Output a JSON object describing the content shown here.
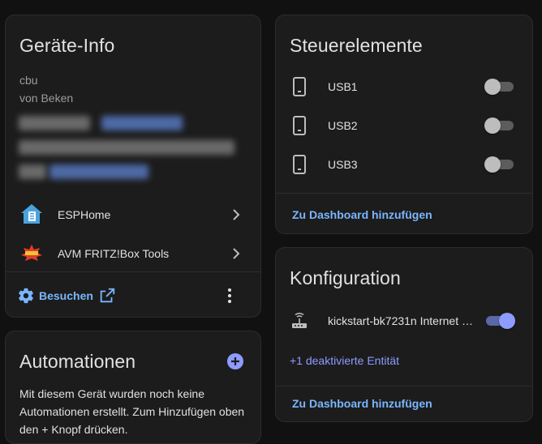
{
  "colors": {
    "background": "#111111",
    "card": "#1c1c1c",
    "link": "#7ab6ff",
    "accent": "#8e9bff",
    "text": "#e1e1e1",
    "muted": "#9b9b9b"
  },
  "device_info": {
    "title": "Geräte-Info",
    "model": "cbu",
    "manufacturer": "von Beken",
    "integrations": [
      {
        "label": "ESPHome",
        "icon": "esphome-icon"
      },
      {
        "label": "AVM FRITZ!Box Tools",
        "icon": "fritzbox-icon"
      }
    ],
    "visit_label": "Besuchen",
    "settings_icon": "gear-icon",
    "external_icon": "external-link-icon",
    "menu_icon": "more-vertical-icon"
  },
  "automations": {
    "title": "Automationen",
    "add_icon": "plus-circle-icon",
    "text": "Mit diesem Gerät wurden noch keine Automationen erstellt. Zum Hinzufügen oben den + Knopf drücken."
  },
  "controls": {
    "title": "Steuerelemente",
    "items": [
      {
        "label": "USB1",
        "icon": "cellphone-icon",
        "state": "off"
      },
      {
        "label": "USB2",
        "icon": "cellphone-icon",
        "state": "off"
      },
      {
        "label": "USB3",
        "icon": "cellphone-icon",
        "state": "off"
      }
    ],
    "add_link": "Zu Dashboard hinzufügen"
  },
  "configuration": {
    "title": "Konfiguration",
    "items": [
      {
        "label": "kickstart-bk7231n Internet …",
        "icon": "router-wireless-icon",
        "state": "on"
      }
    ],
    "disabled_entities": "+1 deaktivierte Entität",
    "add_link": "Zu Dashboard hinzufügen"
  }
}
